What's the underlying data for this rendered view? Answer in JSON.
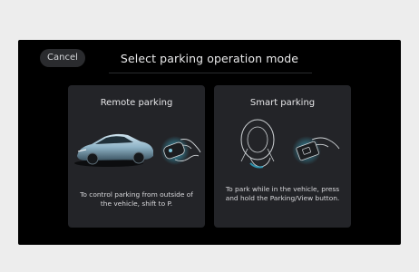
{
  "screen": {
    "cancel_label": "Cancel",
    "title": "Select parking operation mode"
  },
  "cards": [
    {
      "title": "Remote parking",
      "description": "To control parking from outside of the vehicle, shift to P.",
      "icon": "car-with-key-fob-icon"
    },
    {
      "title": "Smart parking",
      "description": "To park while in the vehicle, press and hold the Parking/View button.",
      "icon": "steering-wheel-with-button-icon"
    }
  ],
  "colors": {
    "screen_bg": "#000000",
    "card_bg": "#232428",
    "accent_glow": "#2fa8c8",
    "text": "#e6e6e8"
  }
}
